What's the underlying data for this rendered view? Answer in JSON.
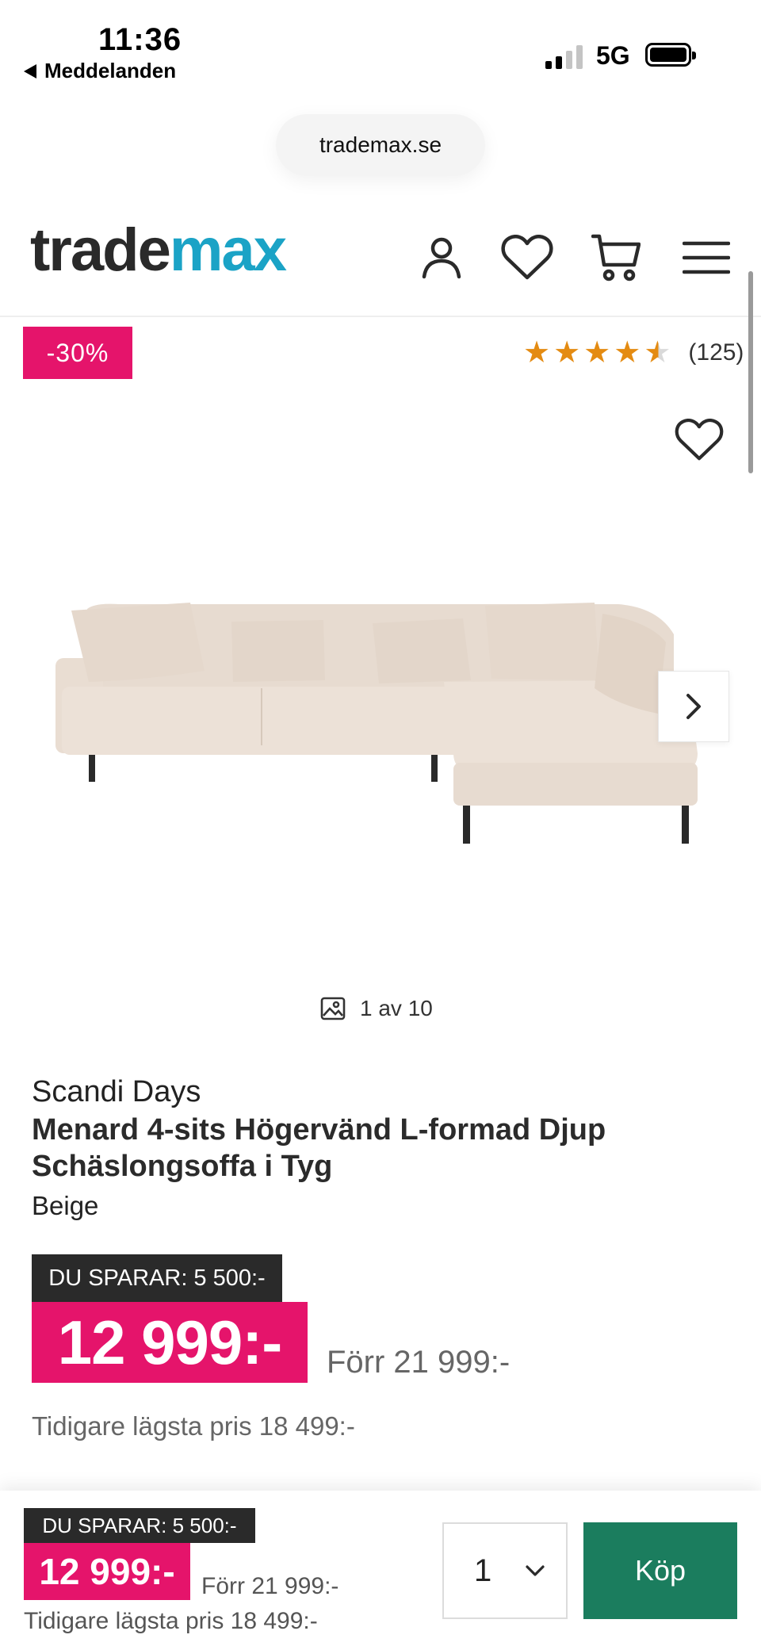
{
  "status_bar": {
    "time": "11:36",
    "back_label": "Meddelanden",
    "network": "5G"
  },
  "browser": {
    "url": "trademax.se"
  },
  "header": {
    "logo_part1": "trade",
    "logo_part2": "max",
    "brand_color": "#1ba3c6",
    "icons": [
      "account-icon",
      "heart-icon",
      "cart-icon",
      "menu-icon"
    ]
  },
  "gallery": {
    "discount_badge": "-30%",
    "rating_value": 4.5,
    "rating_count": "(125)",
    "image_counter": "1 av 10"
  },
  "product": {
    "brand": "Scandi Days",
    "title": "Menard 4-sits Högervänd L-formad Djup Schäslongsoffa i Tyg",
    "color": "Beige",
    "save_label": "DU SPARAR: 5 500:-",
    "price": "12 999:-",
    "old_price": "Förr 21 999:-",
    "lowest_price": "Tidigare lägsta pris 18 499:-",
    "sale_color": "#e5146b"
  },
  "sticky_bar": {
    "save_label": "DU SPARAR: 5 500:-",
    "price": "12 999:-",
    "old_price": "Förr 21 999:-",
    "lowest_price": "Tidigare lägsta pris 18 499:-",
    "quantity": "1",
    "buy_label": "Köp",
    "buy_color": "#1b7d5e"
  }
}
